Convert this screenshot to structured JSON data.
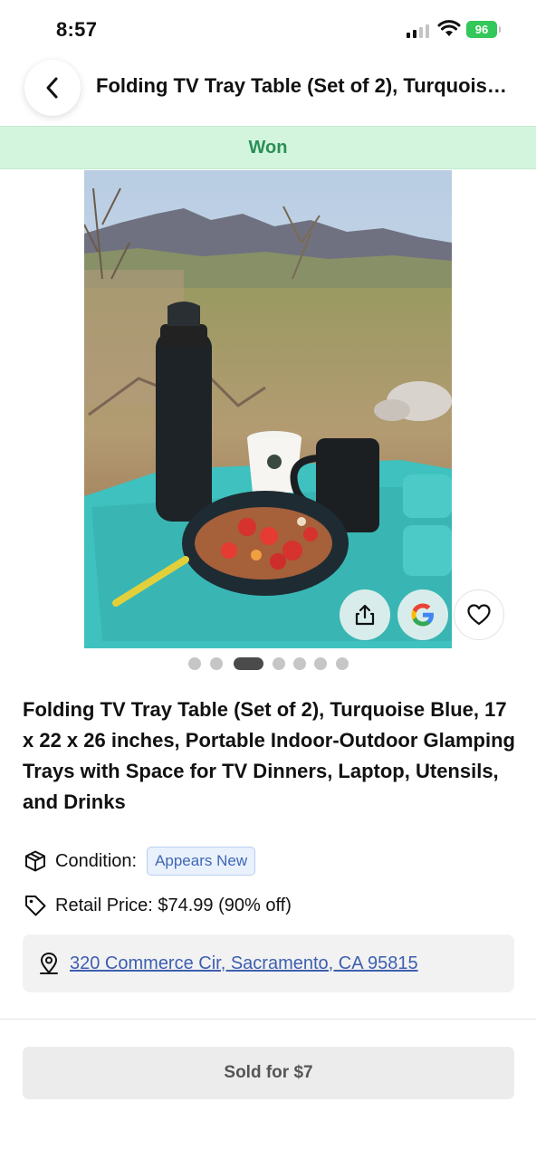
{
  "status_bar": {
    "time": "8:57",
    "battery": "96"
  },
  "header": {
    "back_icon": "chevron-left-icon",
    "title": "Folding TV Tray Table (Set of 2), Turquoise Blue, 17 x 22 x 26 inches, Portable Indoor-Outdoor Glamping Trays with Space for TV Dinners, Laptop, Utensils, and Drinks"
  },
  "banner": {
    "status": "Won",
    "color": "#2a8f56",
    "background": "#d3f5dd"
  },
  "gallery": {
    "image_count": 7,
    "active_index": 2,
    "actions": [
      "share-icon",
      "google-icon",
      "heart-icon"
    ]
  },
  "product": {
    "title": "Folding TV Tray Table (Set of 2), Turquoise Blue, 17 x 22 x 26 inches, Portable Indoor-Outdoor Glamping Trays with Space for TV Dinners, Laptop, Utensils, and Drinks",
    "condition_label": "Condition:",
    "condition_value": "Appears New",
    "retail_price": "Retail Price: $74.99 (90% off)",
    "address": "320 Commerce Cir, Sacramento, CA 95815"
  },
  "footer": {
    "sold_label": "Sold for $7"
  },
  "colors": {
    "accent_link": "#3d5fb0",
    "badge_text": "#3f67b5",
    "tray": "#3fc1bf"
  }
}
